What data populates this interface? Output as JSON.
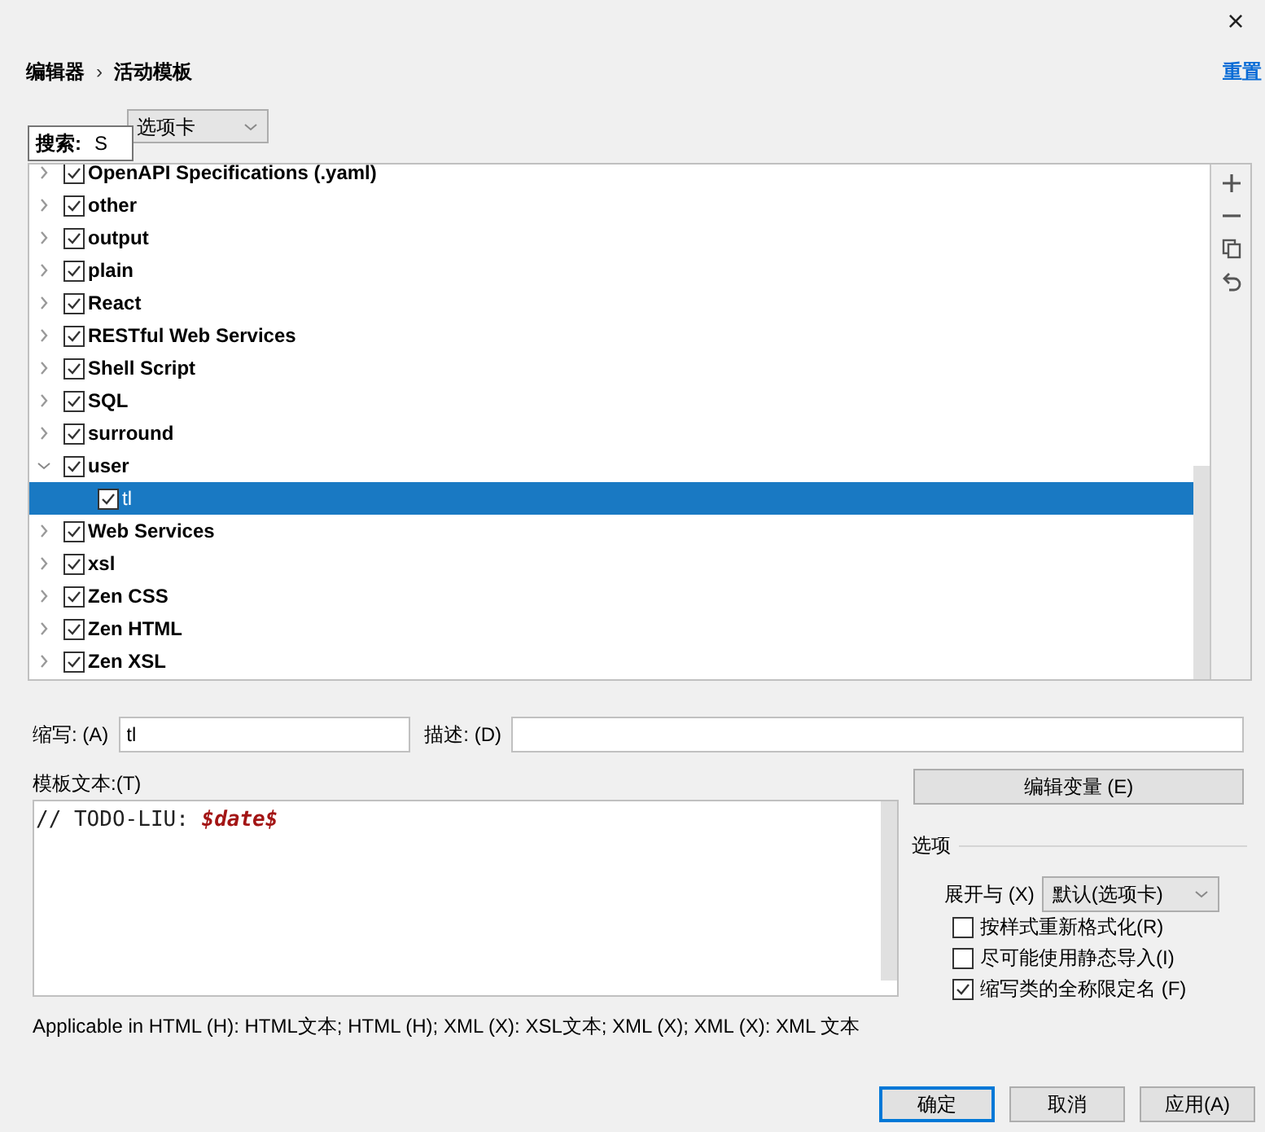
{
  "window": {
    "close": "×"
  },
  "breadcrumb": [
    "编辑器",
    "›",
    "活动模板"
  ],
  "reset_link": "重置",
  "expand_default": {
    "value": "选项卡"
  },
  "search_popup": {
    "label": "搜索:",
    "value": "S"
  },
  "tree": [
    {
      "label": "OpenAPI Specifications (.yaml)",
      "checked": true,
      "expanded": false,
      "selected": false
    },
    {
      "label": "other",
      "checked": true,
      "expanded": false,
      "selected": false
    },
    {
      "label": "output",
      "checked": true,
      "expanded": false,
      "selected": false
    },
    {
      "label": "plain",
      "checked": true,
      "expanded": false,
      "selected": false
    },
    {
      "label": "React",
      "checked": true,
      "expanded": false,
      "selected": false
    },
    {
      "label": "RESTful Web Services",
      "checked": true,
      "expanded": false,
      "selected": false
    },
    {
      "label": "Shell Script",
      "checked": true,
      "expanded": false,
      "selected": false
    },
    {
      "label": "SQL",
      "checked": true,
      "expanded": false,
      "selected": false
    },
    {
      "label": "surround",
      "checked": true,
      "expanded": false,
      "selected": false
    },
    {
      "label": "user",
      "checked": true,
      "expanded": true,
      "selected": false,
      "children": [
        {
          "label": "tl",
          "checked": true,
          "selected": true
        }
      ]
    },
    {
      "label": "Web Services",
      "checked": true,
      "expanded": false,
      "selected": false
    },
    {
      "label": "xsl",
      "checked": true,
      "expanded": false,
      "selected": false
    },
    {
      "label": "Zen CSS",
      "checked": true,
      "expanded": false,
      "selected": false
    },
    {
      "label": "Zen HTML",
      "checked": true,
      "expanded": false,
      "selected": false
    },
    {
      "label": "Zen XSL",
      "checked": true,
      "expanded": false,
      "selected": false
    }
  ],
  "abbreviation": {
    "label": "缩写: (A)",
    "value": "tl"
  },
  "description": {
    "label": "描述: (D)"
  },
  "template_text": {
    "label": "模板文本:(T)",
    "code": "// TODO-LIU: ",
    "variable": "$date$"
  },
  "edit_variables_button": "编辑变量 (E)",
  "options": {
    "title": "选项",
    "expand_with": {
      "label": "展开与 (X)",
      "value": "默认(选项卡)"
    },
    "checkboxes": [
      {
        "label": "按样式重新格式化(R)",
        "checked": false
      },
      {
        "label": "尽可能使用静态导入(I)",
        "checked": false
      },
      {
        "label": "缩写类的全称限定名 (F)",
        "checked": true
      }
    ]
  },
  "applicable": "Applicable in HTML (H): HTML文本; HTML (H); XML (X): XSL文本; XML (X); XML (X): XML 文本",
  "buttons": [
    {
      "label": "确定",
      "default": true
    },
    {
      "label": "取消",
      "default": false
    },
    {
      "label": "应用(A)",
      "default": false
    }
  ]
}
